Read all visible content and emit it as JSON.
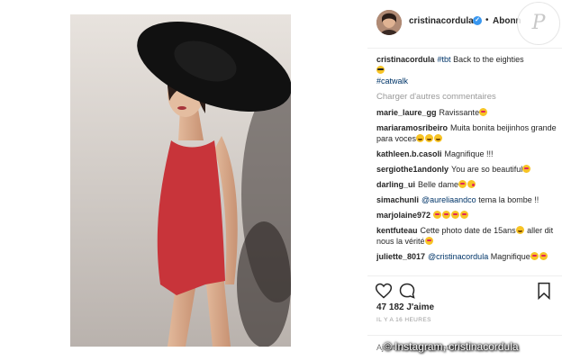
{
  "post": {
    "username": "cristinacordula",
    "follow_label": "Abonn",
    "dot": "•",
    "verified_glyph": "✓",
    "caption_hashtag": "#tbt",
    "caption_text": "Back to the eighties",
    "caption_hashtag2": "#catwalk",
    "load_more_label": "Charger d'autres commentaires",
    "likes_text": "47 182 J'aime",
    "timestamp": "IL Y A 16 HEURES",
    "add_comment_placeholder": "Ajouter un commentaire...",
    "watermark_letter": "P"
  },
  "comments": [
    {
      "user": "marie_laure_gg",
      "text": "Ravissante",
      "emojis": [
        "heart-eyes"
      ]
    },
    {
      "user": "mariaramosribeiro",
      "text": "Muita bonita beijinhos grande para voces",
      "emojis": [
        "laugh",
        "laugh",
        "laugh"
      ]
    },
    {
      "user": "kathleen.b.casoli",
      "text": "Magnifique !!!",
      "emojis": []
    },
    {
      "user": "sergiothe1andonly",
      "text": "You are so beautiful",
      "emojis": [
        "heart-eyes"
      ]
    },
    {
      "user": "darling_ui",
      "text": "Belle dame",
      "emojis": [
        "heart-eyes",
        "kiss"
      ]
    },
    {
      "user": "simachunli",
      "mention": "@aureliaandco",
      "text": "tema la bombe !!",
      "emojis": []
    },
    {
      "user": "marjolaine972",
      "text": "",
      "emojis": [
        "heart-eyes",
        "heart-eyes",
        "heart-eyes",
        "heart-eyes"
      ]
    },
    {
      "user": "kentfuteau",
      "text": "Cette photo date de 15ans",
      "text2": "aller dit nous la vérité",
      "emojis": [
        "laugh"
      ],
      "emojis2": [
        "heart-eyes"
      ]
    },
    {
      "user": "juliette_8017",
      "mention": "@cristinacordula",
      "text": "Magnifique",
      "emojis": [
        "heart-eyes",
        "heart-eyes"
      ]
    }
  ],
  "credit": "© Instagram, cristinacordula",
  "colors": {
    "link": "#003569",
    "muted": "#999999",
    "verified": "#3897f0",
    "dress": "#c8343a",
    "hat": "#111111"
  }
}
